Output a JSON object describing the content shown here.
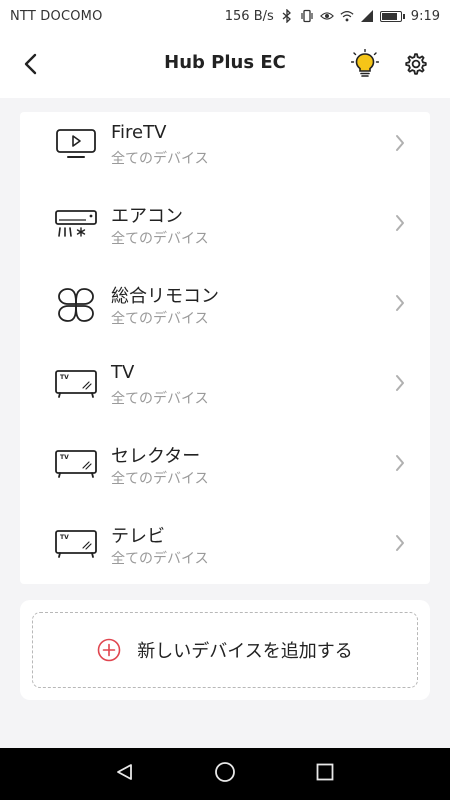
{
  "status_bar": {
    "carrier": "NTT DOCOMO",
    "net_speed": "156 B/s",
    "time": "9:19",
    "icons": [
      "bluetooth-icon",
      "vibrate-icon",
      "eye-icon",
      "wifi-icon",
      "signal-icon",
      "battery-icon"
    ],
    "battery_level": 0.85
  },
  "header": {
    "title": "Hub Plus EC",
    "back_icon": "chevron-left-icon",
    "light_icon": "light-bulb-icon",
    "settings_icon": "gear-icon",
    "accent_color": "#f5c518"
  },
  "devices": [
    {
      "name": "FireTV",
      "subtitle": "全てのデバイス",
      "icon": "fire-tv-icon"
    },
    {
      "name": "エアコン",
      "subtitle": "全てのデバイス",
      "icon": "air-conditioner-icon"
    },
    {
      "name": "総合リモコン",
      "subtitle": "全てのデバイス",
      "icon": "universal-remote-icon"
    },
    {
      "name": "TV",
      "subtitle": "全てのデバイス",
      "icon": "tv-icon"
    },
    {
      "name": "セレクター",
      "subtitle": "全てのデバイス",
      "icon": "tv-icon"
    },
    {
      "name": "テレビ",
      "subtitle": "全てのデバイス",
      "icon": "tv-icon"
    }
  ],
  "add_device": {
    "label": "新しいデバイスを追加する",
    "icon": "plus-circle-icon",
    "icon_color": "#e0454f"
  },
  "nav_bar": {
    "buttons": [
      "back-triangle-icon",
      "home-circle-icon",
      "recents-square-icon"
    ]
  }
}
